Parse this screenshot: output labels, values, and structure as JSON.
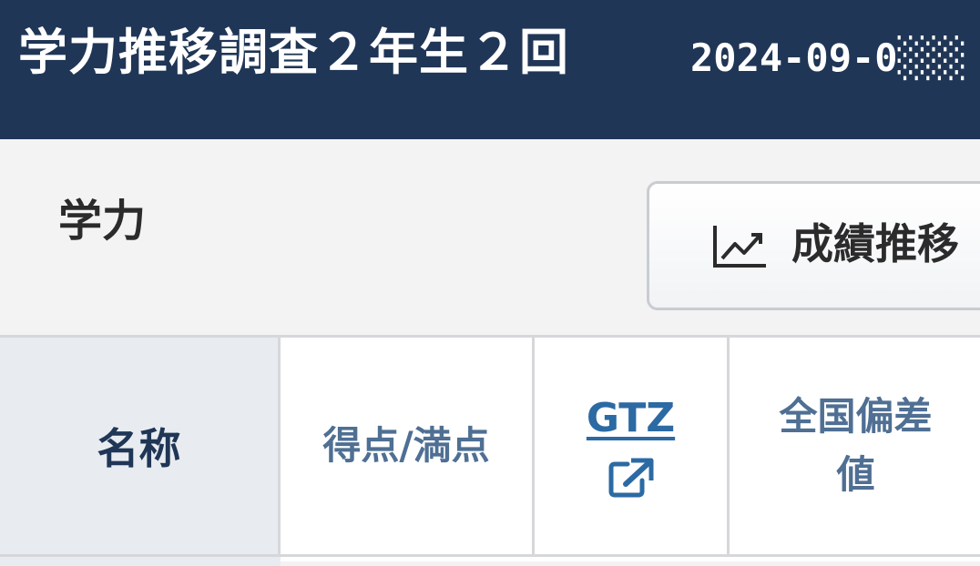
{
  "header": {
    "title": "学力推移調査２年生２回",
    "date": "2024-09-0░░░"
  },
  "section": {
    "title": "学力",
    "trend_button_label": "成績推移",
    "trend_icon": "line-chart-icon"
  },
  "table": {
    "columns": [
      {
        "label": "名称"
      },
      {
        "label": "得点/満点"
      },
      {
        "label": "GTZ",
        "icon": "external-link-icon"
      },
      {
        "label": "全国偏差値"
      }
    ]
  },
  "colors": {
    "header_bg": "#203656",
    "name_header_bg": "#e8ecf0",
    "link": "#2c6aa3"
  }
}
